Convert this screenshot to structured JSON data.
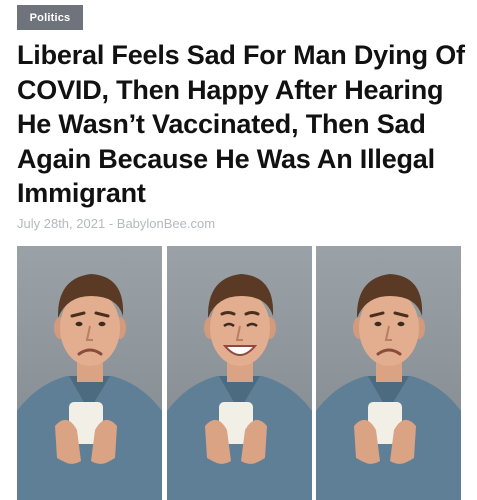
{
  "category": {
    "label": "Politics"
  },
  "article": {
    "title": "Liberal Feels Sad For Man Dying Of COVID, Then Happy After Hearing He Wasn’t Vaccinated, Then Sad Again Because He Was An Illegal Immigrant",
    "date": "July 28th, 2021",
    "separator": "-",
    "source": "BabylonBee.com"
  },
  "photos": [
    {
      "name": "sad-man-photo",
      "expression": "sad"
    },
    {
      "name": "happy-man-photo",
      "expression": "happy"
    },
    {
      "name": "sad-man-photo-2",
      "expression": "sad"
    }
  ],
  "colors": {
    "badge_bg": "#6f747c",
    "title_text": "#111111",
    "meta_text": "#b5b8bd"
  }
}
